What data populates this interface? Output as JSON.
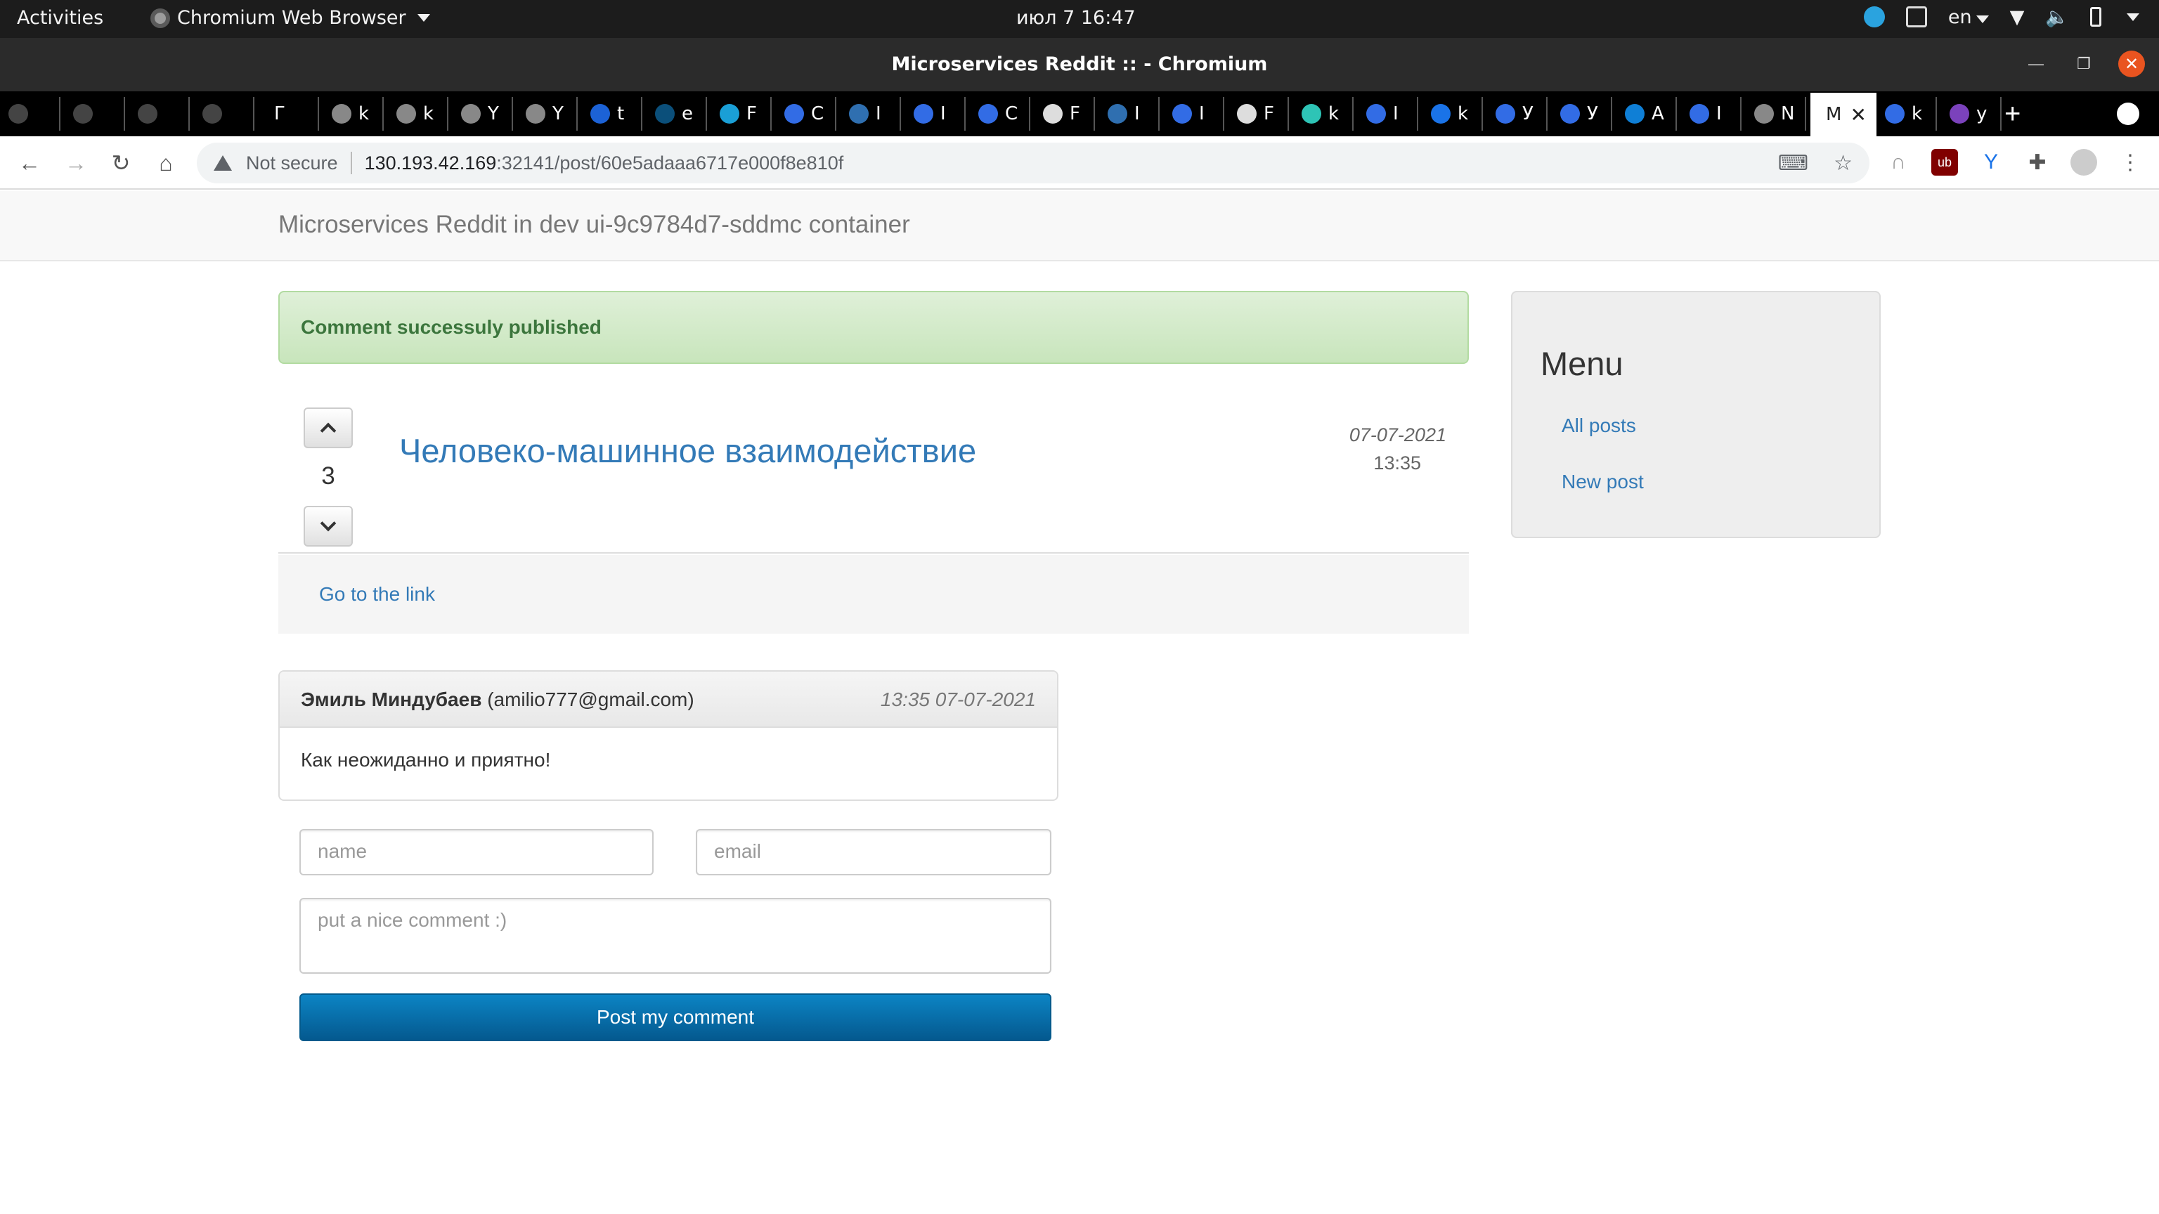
{
  "os_bar": {
    "activities": "Activities",
    "app_name": "Chromium Web Browser",
    "clock": "июл 7  16:47",
    "language": "en"
  },
  "window": {
    "title": "Microservices Reddit :: - Chromium"
  },
  "tabs": [
    {
      "icon": "github-icon",
      "text": "",
      "color": "#444444"
    },
    {
      "icon": "github-icon",
      "text": "",
      "color": "#444444"
    },
    {
      "icon": "github-icon",
      "text": "",
      "color": "#444444"
    },
    {
      "icon": "github-icon",
      "text": "",
      "color": "#444444"
    },
    {
      "icon": "blank-icon",
      "text": "Г",
      "color": "#000000"
    },
    {
      "icon": "globe-icon",
      "text": "k",
      "color": "#888888"
    },
    {
      "icon": "globe-icon",
      "text": "k",
      "color": "#888888"
    },
    {
      "icon": "globe-icon",
      "text": "Y",
      "color": "#888888"
    },
    {
      "icon": "globe-icon",
      "text": "Y",
      "color": "#888888"
    },
    {
      "icon": "yandex-cloud-icon",
      "text": "t",
      "color": "#1c62d6"
    },
    {
      "icon": "docker-icon",
      "text": "e",
      "color": "#0b4f7a"
    },
    {
      "icon": "helm-icon",
      "text": "F",
      "color": "#1a9fd6"
    },
    {
      "icon": "kubernetes-icon",
      "text": "C",
      "color": "#326ce5"
    },
    {
      "icon": "drop-icon",
      "text": "I",
      "color": "#2f6fb0"
    },
    {
      "icon": "kubernetes-icon",
      "text": "I",
      "color": "#326ce5"
    },
    {
      "icon": "kubernetes-icon",
      "text": "C",
      "color": "#326ce5"
    },
    {
      "icon": "flask-icon",
      "text": "F",
      "color": "#dddddd"
    },
    {
      "icon": "drop-icon",
      "text": "I",
      "color": "#2f6fb0"
    },
    {
      "icon": "kubernetes-icon",
      "text": "I",
      "color": "#326ce5"
    },
    {
      "icon": "flask-icon",
      "text": "F",
      "color": "#dddddd"
    },
    {
      "icon": "network-icon",
      "text": "k",
      "color": "#2ec4b6"
    },
    {
      "icon": "kubernetes-icon",
      "text": "I",
      "color": "#326ce5"
    },
    {
      "icon": "spinner-icon",
      "text": "k",
      "color": "#1a73e8"
    },
    {
      "icon": "kubernetes-icon",
      "text": "У",
      "color": "#326ce5"
    },
    {
      "icon": "kubernetes-icon",
      "text": "У",
      "color": "#326ce5"
    },
    {
      "icon": "cube-icon",
      "text": "A",
      "color": "#0f7fd6"
    },
    {
      "icon": "kubernetes-icon",
      "text": "I",
      "color": "#326ce5"
    },
    {
      "icon": "globe-icon",
      "text": "N",
      "color": "#888888"
    },
    {
      "icon": "blank-icon",
      "text": "M",
      "color": "#ffffff",
      "active": true
    },
    {
      "icon": "kubernetes-icon",
      "text": "k",
      "color": "#326ce5"
    },
    {
      "icon": "terraform-icon",
      "text": "y",
      "color": "#7b42bc"
    }
  ],
  "address_bar": {
    "security": "Not secure",
    "host": "130.193.42.169",
    "path": ":32141/post/60e5adaaa6717e000f8e810f"
  },
  "site": {
    "brand": "Microservices Reddit in dev ui-9c9784d7-sddmc container"
  },
  "alert": {
    "message": "Comment successuly published"
  },
  "post": {
    "votes": "3",
    "title": "Человеко-машинное взаимодействие",
    "date": "07-07-2021",
    "time": "13:35",
    "link_label": "Go to the link"
  },
  "comment": {
    "author": "Эмиль Миндубаев",
    "email": "(amilio777@gmail.com)",
    "datetime": "13:35 07-07-2021",
    "text": "Как неожиданно и приятно!"
  },
  "form": {
    "name_placeholder": "name",
    "email_placeholder": "email",
    "comment_placeholder": "put a nice comment :)",
    "submit_label": "Post my comment"
  },
  "sidebar": {
    "title": "Menu",
    "items": [
      {
        "label": "All posts"
      },
      {
        "label": "New post"
      }
    ]
  }
}
